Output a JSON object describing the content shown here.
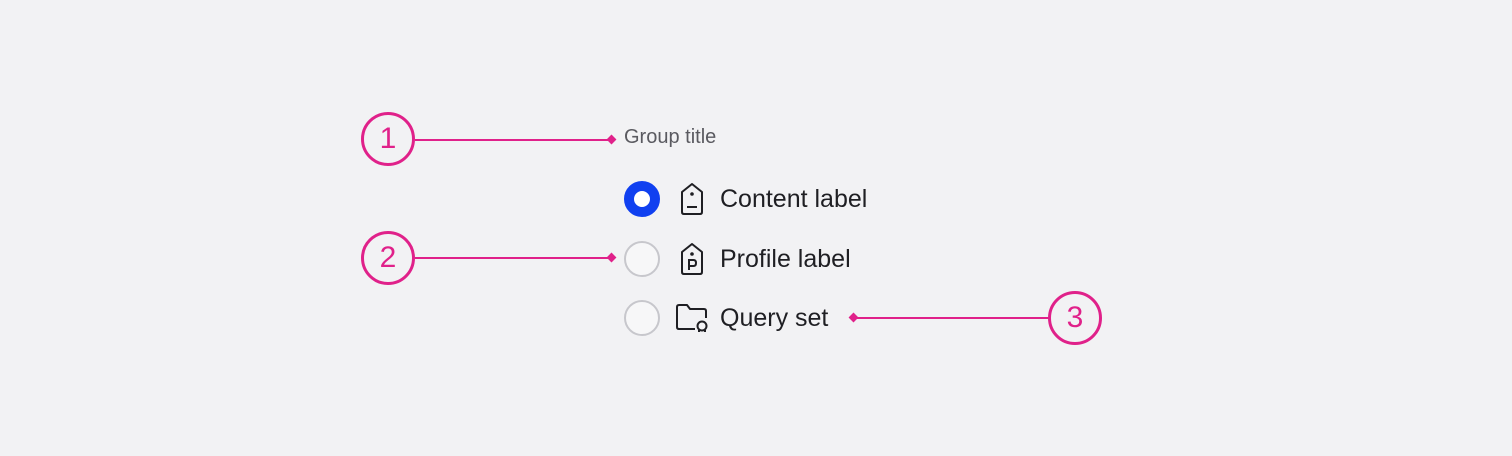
{
  "colors": {
    "accent": "#e0218a",
    "selected": "#1040f0",
    "background": "#f2f2f4"
  },
  "group_title": "Group title",
  "options": [
    {
      "label": "Content label",
      "icon": "tag-icon",
      "selected": true
    },
    {
      "label": "Profile label",
      "icon": "profile-tag-icon",
      "selected": false
    },
    {
      "label": "Query set",
      "icon": "folder-query-icon",
      "selected": false
    }
  ],
  "callouts": [
    "1",
    "2",
    "3"
  ]
}
